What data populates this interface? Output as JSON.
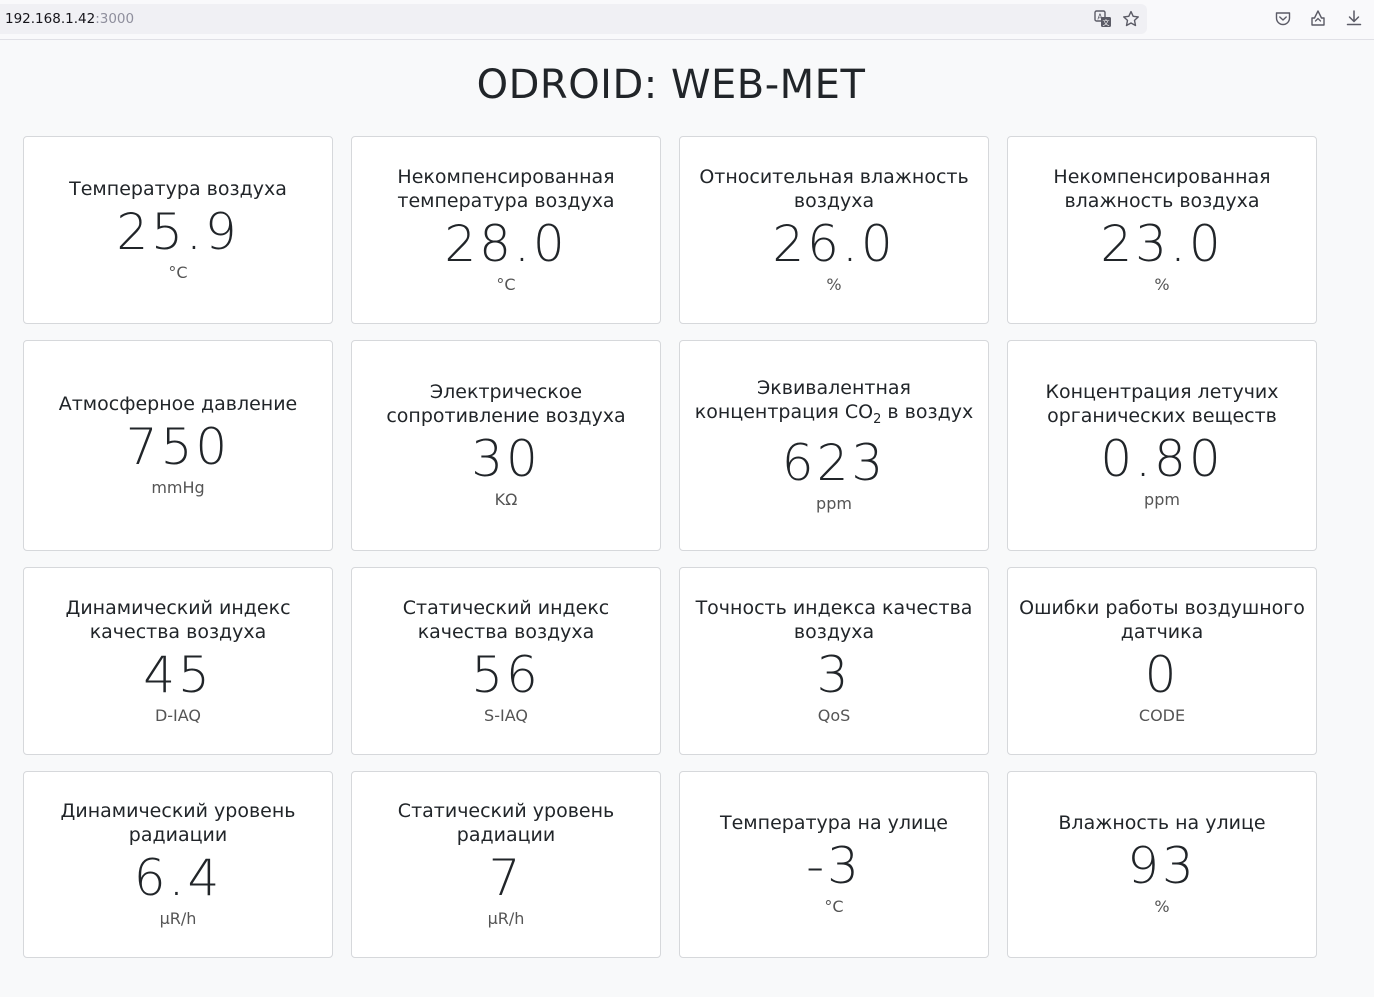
{
  "browser": {
    "url_host": "192.168.1.42",
    "url_port": ":3000",
    "icons": [
      "translate-icon",
      "bookmark-star-icon",
      "pocket-icon",
      "extensions-icon",
      "downloads-icon"
    ]
  },
  "page": {
    "title": "ODROID: WEB-MET"
  },
  "cards": [
    {
      "title": "Температура воздуха",
      "value": "25.9",
      "unit": "°C"
    },
    {
      "title": "Некомпенсированная температура воздуха",
      "value": "28.0",
      "unit": "°C"
    },
    {
      "title": "Относительная влажность воздуха",
      "value": "26.0",
      "unit": "%"
    },
    {
      "title": "Некомпенсированная влажность воздуха",
      "value": "23.0",
      "unit": "%"
    },
    {
      "title": "Атмосферное давление",
      "value": "750",
      "unit": "mmHg"
    },
    {
      "title": "Электрическое сопротивление воздуха",
      "value": "30",
      "unit": "KΩ"
    },
    {
      "title_pre": "Эквивалентная концентрация CO",
      "title_sub": "2",
      "title_post": " в воздух",
      "value": "623",
      "unit": "ppm"
    },
    {
      "title": "Концентрация летучих органических веществ",
      "value": "0.80",
      "unit": "ppm"
    },
    {
      "title": "Динамический индекс качества воздуха",
      "value": "45",
      "unit": "D-IAQ"
    },
    {
      "title": "Статический индекс качества воздуха",
      "value": "56",
      "unit": "S-IAQ"
    },
    {
      "title": "Точность индекса качества воздуха",
      "value": "3",
      "unit": "QoS"
    },
    {
      "title": "Ошибки работы воздушного датчика",
      "value": "0",
      "unit": "CODE"
    },
    {
      "title": "Динамический уровень радиации",
      "value": "6.4",
      "unit": "µR/h"
    },
    {
      "title": "Статический уровень радиации",
      "value": "7",
      "unit": "µR/h"
    },
    {
      "title": "Температура на улице",
      "value": "-3",
      "unit": "°C"
    },
    {
      "title": "Влажность на улице",
      "value": "93",
      "unit": "%"
    }
  ]
}
